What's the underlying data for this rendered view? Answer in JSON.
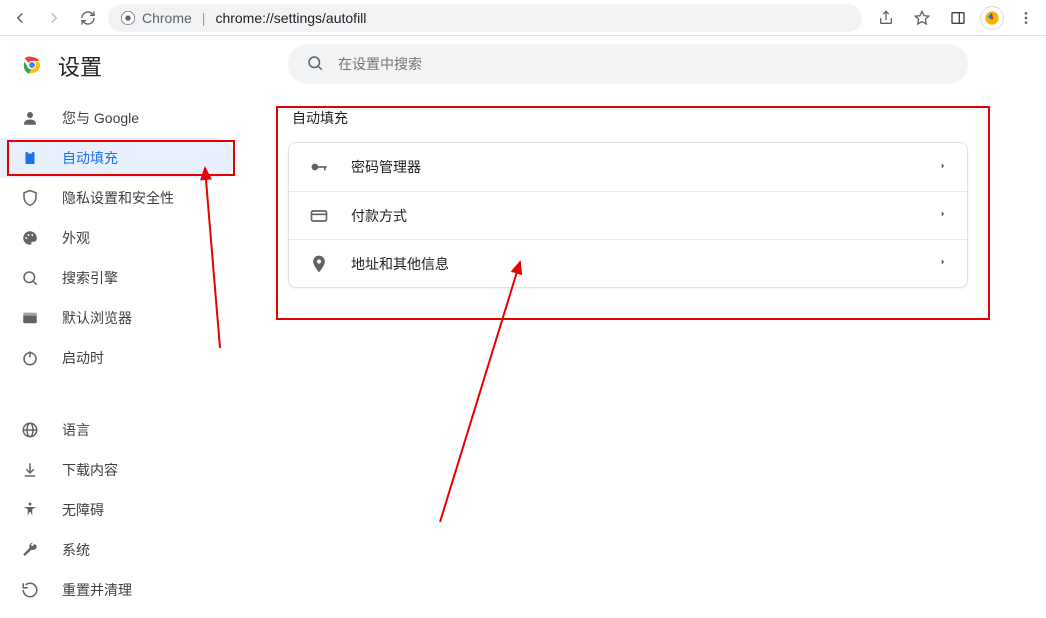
{
  "toolbar": {
    "chrome_label": "Chrome",
    "url": "chrome://settings/autofill"
  },
  "app": {
    "title": "设置"
  },
  "search": {
    "placeholder": "在设置中搜索"
  },
  "sidebar": {
    "group1": [
      {
        "id": "you-and-google",
        "label": "您与 Google"
      },
      {
        "id": "autofill",
        "label": "自动填充",
        "active": true
      },
      {
        "id": "privacy",
        "label": "隐私设置和安全性"
      },
      {
        "id": "appearance",
        "label": "外观"
      },
      {
        "id": "search-engine",
        "label": "搜索引擎"
      },
      {
        "id": "default-browser",
        "label": "默认浏览器"
      },
      {
        "id": "on-startup",
        "label": "启动时"
      }
    ],
    "group2": [
      {
        "id": "languages",
        "label": "语言"
      },
      {
        "id": "downloads",
        "label": "下载内容"
      },
      {
        "id": "accessibility",
        "label": "无障碍"
      },
      {
        "id": "system",
        "label": "系统"
      },
      {
        "id": "reset",
        "label": "重置并清理"
      }
    ]
  },
  "section": {
    "title": "自动填充",
    "rows": [
      {
        "id": "passwords",
        "label": "密码管理器"
      },
      {
        "id": "payments",
        "label": "付款方式"
      },
      {
        "id": "addresses",
        "label": "地址和其他信息"
      }
    ]
  }
}
